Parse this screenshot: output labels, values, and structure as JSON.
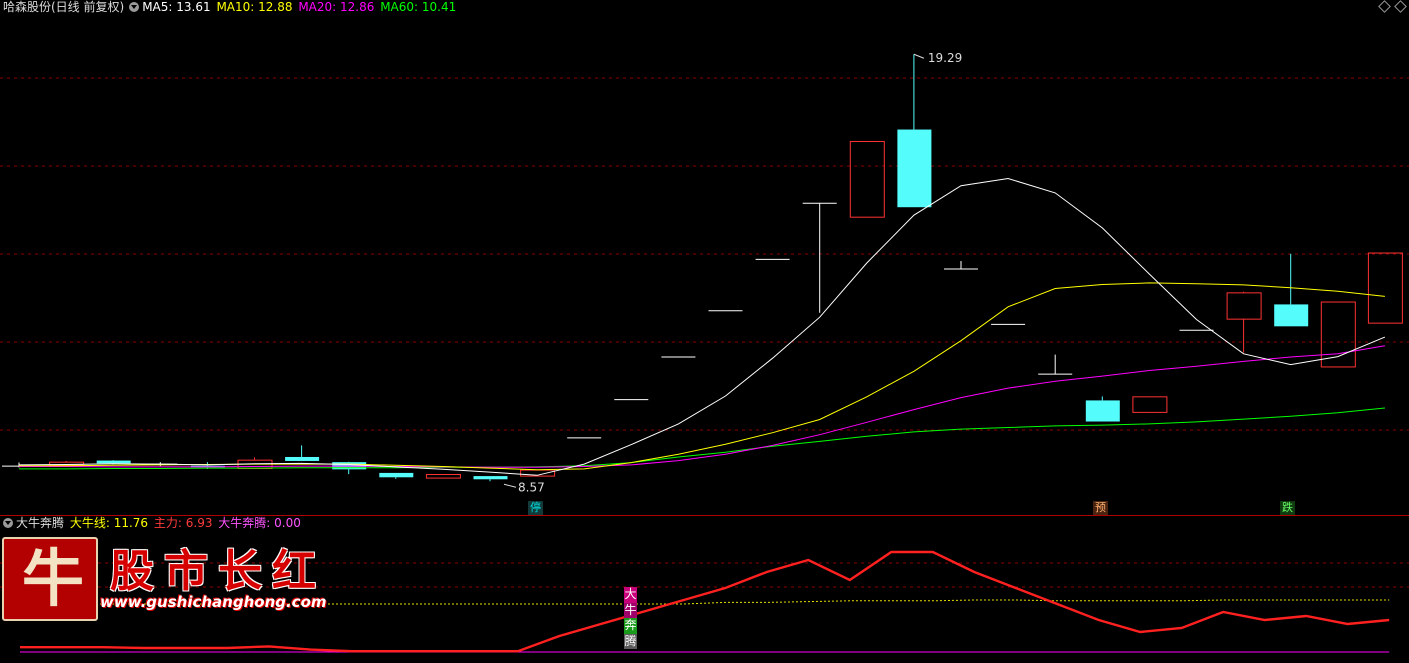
{
  "main_panel": {
    "title": "哈森股份(日线 前复权)",
    "ma5": "MA5: 13.61",
    "ma10": "MA10: 12.88",
    "ma20": "MA20: 12.86",
    "ma60": "MA60: 10.41",
    "high_label": "19.29",
    "low_label": "8.57",
    "signal_labels": [
      {
        "text": "停",
        "color": "#00d6d6"
      },
      {
        "text": "预",
        "color": "#e07a30"
      },
      {
        "text": "跌",
        "color": "#48e048"
      }
    ]
  },
  "sub_panel": {
    "title": "大牛奔腾",
    "line1": "大牛线: 11.76",
    "line2": "主力: 6.93",
    "line3": "大牛奔腾: 0.00",
    "tag_chars": [
      "大",
      "牛",
      "奔",
      "腾"
    ]
  },
  "watermark": {
    "glyph": "牛",
    "name": "股市长红",
    "url": "www.gushichanghong.com"
  },
  "colors": {
    "up": "#ff3232",
    "down": "#54fcfc",
    "flat": "#ffffff",
    "ma5": "#ffffff",
    "ma10": "#ffff00",
    "ma20": "#ff00ff",
    "ma60": "#00ff00",
    "grid": "#8b0000"
  },
  "chart_data": {
    "type": "candlestick",
    "ylim": [
      8.1,
      20.2
    ],
    "candles": [
      {
        "o": 8.95,
        "h": 9.04,
        "l": 8.92,
        "c": 8.95
      },
      {
        "o": 8.98,
        "h": 9.08,
        "l": 8.95,
        "c": 9.05
      },
      {
        "o": 9.09,
        "h": 9.1,
        "l": 8.99,
        "c": 9.02
      },
      {
        "o": 9.0,
        "h": 9.05,
        "l": 8.95,
        "c": 9.0
      },
      {
        "o": 8.96,
        "h": 9.05,
        "l": 8.88,
        "c": 8.92
      },
      {
        "o": 8.89,
        "h": 9.17,
        "l": 8.89,
        "c": 9.1
      },
      {
        "o": 9.18,
        "h": 9.47,
        "l": 9.09,
        "c": 9.08
      },
      {
        "o": 9.05,
        "h": 9.06,
        "l": 8.75,
        "c": 8.87
      },
      {
        "o": 8.78,
        "h": 8.78,
        "l": 8.63,
        "c": 8.67
      },
      {
        "o": 8.65,
        "h": 8.75,
        "l": 8.65,
        "c": 8.74
      },
      {
        "o": 8.7,
        "h": 8.7,
        "l": 8.57,
        "c": 8.62
      },
      {
        "o": 8.7,
        "h": 8.87,
        "l": 8.7,
        "c": 8.85
      },
      {
        "o": 9.66,
        "h": 9.66,
        "l": 9.66,
        "c": 9.66
      },
      {
        "o": 10.62,
        "h": 10.62,
        "l": 10.62,
        "c": 10.62
      },
      {
        "o": 11.69,
        "h": 11.69,
        "l": 11.69,
        "c": 11.69
      },
      {
        "o": 12.85,
        "h": 12.85,
        "l": 12.85,
        "c": 12.85
      },
      {
        "o": 14.14,
        "h": 14.14,
        "l": 14.14,
        "c": 14.14
      },
      {
        "o": 15.55,
        "h": 15.55,
        "l": 12.8,
        "c": 15.55
      },
      {
        "o": 15.2,
        "h": 17.1,
        "l": 15.2,
        "c": 17.1
      },
      {
        "o": 17.4,
        "h": 19.29,
        "l": 15.45,
        "c": 15.45
      },
      {
        "o": 13.9,
        "h": 14.1,
        "l": 13.9,
        "c": 13.9
      },
      {
        "o": 12.51,
        "h": 12.51,
        "l": 12.51,
        "c": 12.51
      },
      {
        "o": 11.26,
        "h": 11.75,
        "l": 11.26,
        "c": 11.26
      },
      {
        "o": 10.6,
        "h": 10.7,
        "l": 10.07,
        "c": 10.07
      },
      {
        "o": 10.3,
        "h": 10.69,
        "l": 10.3,
        "c": 10.69
      },
      {
        "o": 12.36,
        "h": 12.36,
        "l": 12.36,
        "c": 12.36
      },
      {
        "o": 12.64,
        "h": 13.33,
        "l": 11.8,
        "c": 13.3
      },
      {
        "o": 13.01,
        "h": 14.28,
        "l": 12.46,
        "c": 12.46
      },
      {
        "o": 11.44,
        "h": 13.07,
        "l": 11.44,
        "c": 13.07
      },
      {
        "o": 12.54,
        "h": 14.3,
        "l": 12.54,
        "c": 14.3
      }
    ],
    "ma5_values": [
      8.98,
      8.99,
      9.01,
      9.0,
      8.98,
      9.01,
      9.02,
      8.99,
      8.93,
      8.87,
      8.8,
      8.72,
      9.0,
      9.49,
      10.01,
      10.71,
      11.66,
      12.69,
      14.05,
      15.25,
      15.99,
      16.17,
      15.81,
      14.93,
      13.77,
      12.63,
      11.77,
      11.5,
      11.7,
      12.19
    ],
    "ma10_values": [
      8.96,
      8.96,
      8.97,
      8.98,
      8.99,
      9.0,
      9.0,
      9.0,
      8.97,
      8.94,
      8.9,
      8.86,
      8.88,
      9.04,
      9.25,
      9.5,
      9.79,
      10.12,
      10.69,
      11.33,
      12.1,
      12.95,
      13.41,
      13.51,
      13.55,
      13.53,
      13.5,
      13.43,
      13.34,
      13.21
    ],
    "ma20_values": [
      8.94,
      8.94,
      8.93,
      8.93,
      8.93,
      8.94,
      8.95,
      8.95,
      8.94,
      8.93,
      8.92,
      8.92,
      8.94,
      8.98,
      9.09,
      9.25,
      9.47,
      9.74,
      10.05,
      10.37,
      10.67,
      10.91,
      11.08,
      11.21,
      11.35,
      11.46,
      11.58,
      11.69,
      11.77,
      11.97
    ],
    "ma60_values": [
      8.88,
      8.88,
      8.89,
      8.89,
      8.9,
      8.9,
      8.91,
      8.91,
      8.91,
      8.92,
      8.92,
      8.93,
      8.96,
      9.04,
      9.18,
      9.3,
      9.45,
      9.57,
      9.7,
      9.81,
      9.88,
      9.92,
      9.96,
      9.98,
      10.01,
      10.06,
      10.13,
      10.2,
      10.29,
      10.41
    ],
    "signals": [
      {
        "index": 11,
        "label": "停"
      },
      {
        "index": 23,
        "label": "预"
      },
      {
        "index": 27,
        "label": "跌"
      }
    ],
    "sub_ylim": [
      0,
      140
    ],
    "main_force_values": [
      6,
      6,
      6,
      5,
      5,
      5,
      7,
      3,
      1,
      1,
      1,
      1,
      1,
      20,
      35,
      50,
      65,
      80,
      100,
      115,
      90,
      125,
      125,
      100,
      80,
      60,
      40,
      25,
      30,
      50,
      40,
      45,
      35,
      40
    ],
    "bull_line_values": [
      60,
      60,
      60,
      60,
      60,
      60,
      60,
      60,
      60,
      60,
      60,
      60,
      60,
      60,
      60,
      60,
      60,
      62,
      62,
      63,
      64,
      64,
      64,
      65,
      65,
      64,
      64,
      64,
      64,
      65,
      65,
      65,
      65,
      65
    ],
    "bull_run_values": [
      0,
      0,
      0,
      0,
      0,
      0,
      0,
      0,
      0,
      0,
      0,
      0,
      0,
      0,
      0,
      0,
      0,
      0,
      0,
      0,
      0,
      0,
      0,
      0,
      0,
      0,
      0,
      0,
      0,
      0,
      0,
      0,
      0,
      0
    ]
  }
}
